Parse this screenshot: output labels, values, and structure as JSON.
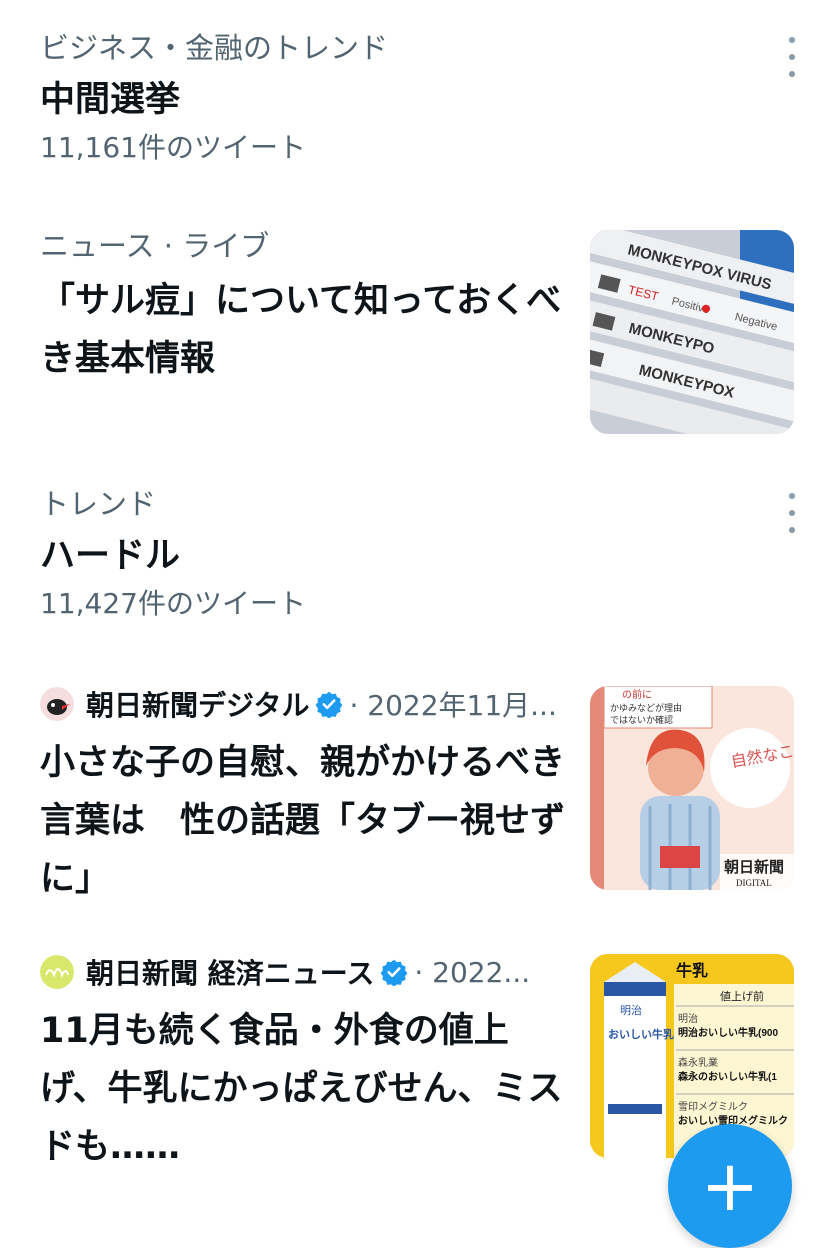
{
  "trends": [
    {
      "category": "ビジネス・金融のトレンド",
      "title": "中間選挙",
      "count": "11,161件のツイート"
    },
    {
      "category": "トレンド",
      "title": "ハードル",
      "count": "11,427件のツイート"
    }
  ],
  "live_news": {
    "category": "ニュース · ライブ",
    "title": "「サル痘」について知っておくべき基本情報",
    "image_text": {
      "line1": "MONKEYPOX VIRUS",
      "line2": "TEST",
      "line3": "Positive",
      "line4": "Negative",
      "line5": "MONKEYPO",
      "line6": "MONKEYPOX"
    }
  },
  "news_items": [
    {
      "source": "朝日新聞デジタル",
      "date": "· 2022年11月...",
      "title": "小さな子の自慰、親がかけるべき言葉は　性の話題「タブー視せずに」",
      "image_text": {
        "bubble": "自然なことよね",
        "caption_top": "の前に",
        "caption_line1": "かゆみなどが理由",
        "caption_line2": "ではないか確認",
        "brand": "朝日新聞",
        "brand_sub": "DIGITAL"
      }
    },
    {
      "source": "朝日新聞 経済ニュース",
      "date": "· 2022...",
      "title": "11月も続く食品・外食の値上げ、牛乳にかっぱえびせん、ミスドも……",
      "image_text": {
        "heading": "牛乳",
        "col_header": "値上げ前",
        "maker1": "明治",
        "product1": "明治おいしい牛乳(900",
        "maker2": "森永乳業",
        "product2": "森永のおいしい牛乳(1",
        "maker3": "雪印メグミルク",
        "product3": "おいしい雪印メグミルク",
        "carton_brand": "明治",
        "carton_name": "おいしい牛乳"
      }
    }
  ],
  "fab": {
    "label": "+"
  },
  "colors": {
    "primary_text": "#0f1419",
    "secondary_text": "#536471",
    "accent": "#1d9bf0",
    "verified": "#1d9bf0"
  },
  "icons": {
    "more": "more-vertical-icon",
    "verified": "verified-badge-icon",
    "compose": "plus-icon"
  }
}
